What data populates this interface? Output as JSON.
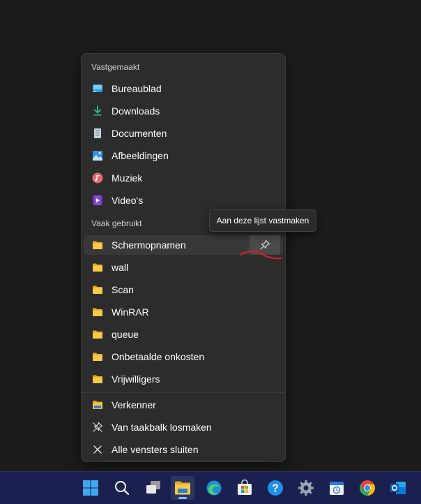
{
  "jumplist": {
    "pinned_header": "Vastgemaakt",
    "pinned_items": [
      {
        "label": "Bureaublad",
        "icon": "desktop-icon"
      },
      {
        "label": "Downloads",
        "icon": "download-icon"
      },
      {
        "label": "Documenten",
        "icon": "document-icon"
      },
      {
        "label": "Afbeeldingen",
        "icon": "pictures-icon"
      },
      {
        "label": "Muziek",
        "icon": "music-icon"
      },
      {
        "label": "Video's",
        "icon": "video-icon"
      }
    ],
    "frequent_header": "Vaak gebruikt",
    "frequent_items": [
      {
        "label": "Schermopnamen",
        "icon": "folder-icon"
      },
      {
        "label": "wall",
        "icon": "folder-icon"
      },
      {
        "label": "Scan",
        "icon": "folder-icon"
      },
      {
        "label": "WinRAR",
        "icon": "folder-icon"
      },
      {
        "label": "queue",
        "icon": "folder-icon"
      },
      {
        "label": "Onbetaalde onkosten",
        "icon": "folder-icon"
      },
      {
        "label": "Vrijwilligers",
        "icon": "folder-icon"
      }
    ],
    "actions": [
      {
        "label": "Verkenner",
        "icon": "file-explorer-icon"
      },
      {
        "label": "Van taakbalk losmaken",
        "icon": "unpin-icon"
      },
      {
        "label": "Alle vensters sluiten",
        "icon": "close-icon"
      }
    ],
    "tooltip": "Aan deze lijst vastmaken"
  },
  "taskbar": {
    "apps": [
      {
        "name": "start-button",
        "icon": "windows-logo-icon"
      },
      {
        "name": "search-button",
        "icon": "search-icon"
      },
      {
        "name": "task-view-button",
        "icon": "task-view-icon"
      },
      {
        "name": "file-explorer-taskbar",
        "icon": "file-explorer-icon",
        "active": true
      },
      {
        "name": "edge-taskbar",
        "icon": "edge-icon"
      },
      {
        "name": "store-taskbar",
        "icon": "store-icon"
      },
      {
        "name": "help-taskbar",
        "icon": "help-icon"
      },
      {
        "name": "settings-taskbar",
        "icon": "gear-icon"
      },
      {
        "name": "calendar-taskbar",
        "icon": "calendar-icon"
      },
      {
        "name": "chrome-taskbar",
        "icon": "chrome-icon"
      },
      {
        "name": "outlook-taskbar",
        "icon": "outlook-icon"
      }
    ]
  },
  "colors": {
    "accent": "#7cc0ff",
    "folder": "#f5c542",
    "annotation": "#d0202a"
  }
}
